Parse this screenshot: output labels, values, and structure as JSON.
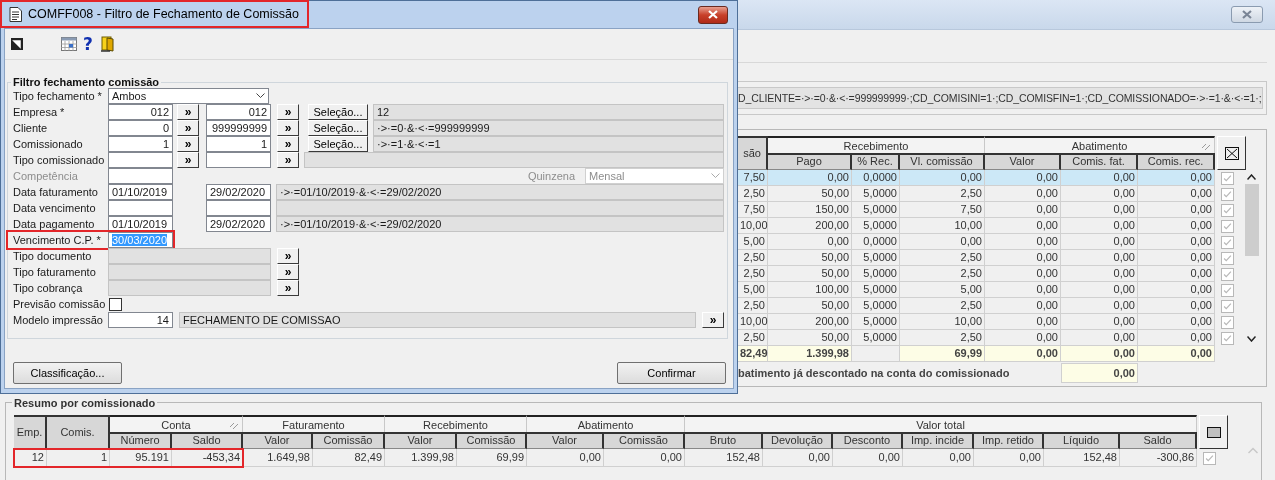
{
  "dialog": {
    "title": {
      "text": "COMFF008 - Filtro de Fechamento de Comissão",
      "highlighted": true
    },
    "toolbar": [
      {
        "kind": "pointer"
      },
      {
        "kind": "calendar"
      },
      {
        "kind": "help",
        "label": "?"
      },
      {
        "kind": "exit"
      }
    ],
    "group_title": "Filtro fechamento comissão",
    "rows": [
      {
        "kind": "select",
        "label": "Tipo fechamento *",
        "value": "Ambos"
      },
      {
        "kind": "range",
        "label": "Empresa *",
        "from": "012",
        "to": "012",
        "lookup_buttons": [
          "»",
          "»"
        ],
        "selection_button": "Seleção...",
        "display": "12"
      },
      {
        "kind": "range",
        "label": "Cliente",
        "from": "0",
        "to": "999999999",
        "lookup_buttons": [
          "»",
          "»"
        ],
        "selection_button": "Seleção...",
        "display": "·>·=0·&·<·=999999999"
      },
      {
        "kind": "range",
        "label": "Comissionado",
        "from": "1",
        "to": "1",
        "lookup_buttons": [
          "»",
          "»"
        ],
        "selection_button": "Seleção...",
        "display": "·>·=1·&·<·=1"
      },
      {
        "kind": "range",
        "label": "Tipo comissionado",
        "lookup_buttons": [
          "»",
          "»"
        ]
      },
      {
        "kind": "competencia",
        "label": "Competência",
        "disabled": true,
        "period_label": "Quinzena",
        "period_value": "Mensal"
      },
      {
        "kind": "date_range",
        "label": "Data faturamento",
        "from": "01/10/2019",
        "to": "29/02/2020",
        "display": "·>·=01/10/2019·&·<·=29/02/2020"
      },
      {
        "kind": "date_range",
        "label": "Data vencimento"
      },
      {
        "kind": "date_range",
        "label": "Data pagamento",
        "from": "01/10/2019",
        "to": "29/02/2020",
        "display": "·>·=01/10/2019·&·<·=29/02/2020"
      },
      {
        "kind": "date",
        "label": "Vencimento C.P. *",
        "value": "30/03/2020",
        "text_selected": true,
        "highlighted": true
      },
      {
        "kind": "lookup",
        "label": "Tipo documento",
        "lookup_buttons": [
          "»"
        ]
      },
      {
        "kind": "lookup",
        "label": "Tipo faturamento",
        "lookup_buttons": [
          "»"
        ]
      },
      {
        "kind": "lookup",
        "label": "Tipo cobrança",
        "lookup_buttons": [
          "»"
        ]
      },
      {
        "kind": "checkbox",
        "label": "Previsão comissão",
        "checked": false
      },
      {
        "kind": "model",
        "label": "Modelo impressão",
        "value": "14",
        "display": "FECHAMENTO DE COMISSAO",
        "lookup_buttons": [
          "»"
        ]
      }
    ],
    "buttons": [
      {
        "label": "Classificação..."
      },
      {
        "label": "Confirmar"
      }
    ]
  },
  "main_window": {
    "filter_string": "D_CLIENTE=·>·=0·&·<·=999999999·;CD_COMISINI=1·;CD_COMISFIN=1·;CD_COMISSIONADO=·>·=1·&·<·=1·;",
    "detail_table": {
      "column_groups": [
        {
          "columns": [
            "são"
          ]
        },
        {
          "label": "Recebimento",
          "columns": [
            "Pago",
            "% Rec.",
            "Vl. comissão"
          ]
        },
        {
          "label": "Abatimento",
          "columns": [
            "Valor",
            "Comis. fat.",
            "Comis. rec."
          ],
          "has_grip": true
        }
      ],
      "rows": [
        {
          "cells": [
            "7,50",
            "0,00",
            "0,0000",
            "0,00",
            "0,00",
            "0,00",
            "0,00"
          ],
          "selected": true,
          "checked": true
        },
        {
          "cells": [
            "2,50",
            "50,00",
            "5,0000",
            "2,50",
            "0,00",
            "0,00",
            "0,00"
          ],
          "selected": false,
          "checked": true
        },
        {
          "cells": [
            "7,50",
            "150,00",
            "5,0000",
            "7,50",
            "0,00",
            "0,00",
            "0,00"
          ],
          "selected": false,
          "checked": true
        },
        {
          "cells": [
            "10,00",
            "200,00",
            "5,0000",
            "10,00",
            "0,00",
            "0,00",
            "0,00"
          ],
          "selected": false,
          "checked": true
        },
        {
          "cells": [
            "5,00",
            "0,00",
            "0,0000",
            "0,00",
            "0,00",
            "0,00",
            "0,00"
          ],
          "selected": false,
          "checked": true
        },
        {
          "cells": [
            "2,50",
            "50,00",
            "5,0000",
            "2,50",
            "0,00",
            "0,00",
            "0,00"
          ],
          "selected": false,
          "checked": true
        },
        {
          "cells": [
            "2,50",
            "50,00",
            "5,0000",
            "2,50",
            "0,00",
            "0,00",
            "0,00"
          ],
          "selected": false,
          "checked": true
        },
        {
          "cells": [
            "5,00",
            "100,00",
            "5,0000",
            "5,00",
            "0,00",
            "0,00",
            "0,00"
          ],
          "selected": false,
          "checked": true
        },
        {
          "cells": [
            "2,50",
            "50,00",
            "5,0000",
            "2,50",
            "0,00",
            "0,00",
            "0,00"
          ],
          "selected": false,
          "checked": true
        },
        {
          "cells": [
            "10,00",
            "200,00",
            "5,0000",
            "10,00",
            "0,00",
            "0,00",
            "0,00"
          ],
          "selected": false,
          "checked": true
        },
        {
          "cells": [
            "2,50",
            "50,00",
            "5,0000",
            "2,50",
            "0,00",
            "0,00",
            "0,00"
          ],
          "selected": false,
          "checked": true
        }
      ],
      "totals": [
        {
          "value": "82,49"
        },
        {
          "value": "1.399,98"
        },
        {
          "value": "69,99",
          "gap_before": true
        },
        {
          "value": "0,00"
        },
        {
          "value": "0,00"
        },
        {
          "value": "0,00"
        }
      ],
      "footer_note": {
        "text": "batimento já descontado na conta do comissionado",
        "value": "0,00"
      }
    }
  },
  "summary": {
    "title": "Resumo por comissionado",
    "column_groups": [
      {
        "columns": [
          "Emp."
        ]
      },
      {
        "columns": [
          "Comis."
        ]
      },
      {
        "label": "Conta",
        "columns": [
          "Número",
          "Saldo"
        ],
        "has_grip": true
      },
      {
        "label": "Faturamento",
        "columns": [
          "Valor",
          "Comissão"
        ]
      },
      {
        "label": "Recebimento",
        "columns": [
          "Valor",
          "Comissão"
        ]
      },
      {
        "label": "Abatimento",
        "columns": [
          "Valor",
          "Comissão"
        ]
      },
      {
        "label": "Valor total",
        "columns": [
          "Bruto",
          "Devolução",
          "Desconto",
          "Imp. incide",
          "Imp. retido",
          "Líquido",
          "Saldo"
        ]
      }
    ],
    "rows": [
      {
        "cells": [
          "12",
          "1",
          "95.191",
          "-453,34",
          "1.649,98",
          "82,49",
          "1.399,98",
          "69,99",
          "0,00",
          "0,00",
          "152,48",
          "0,00",
          "0,00",
          "0,00",
          "0,00",
          "152,48",
          "-300,86"
        ],
        "checked": true,
        "highlighted": true
      }
    ]
  }
}
